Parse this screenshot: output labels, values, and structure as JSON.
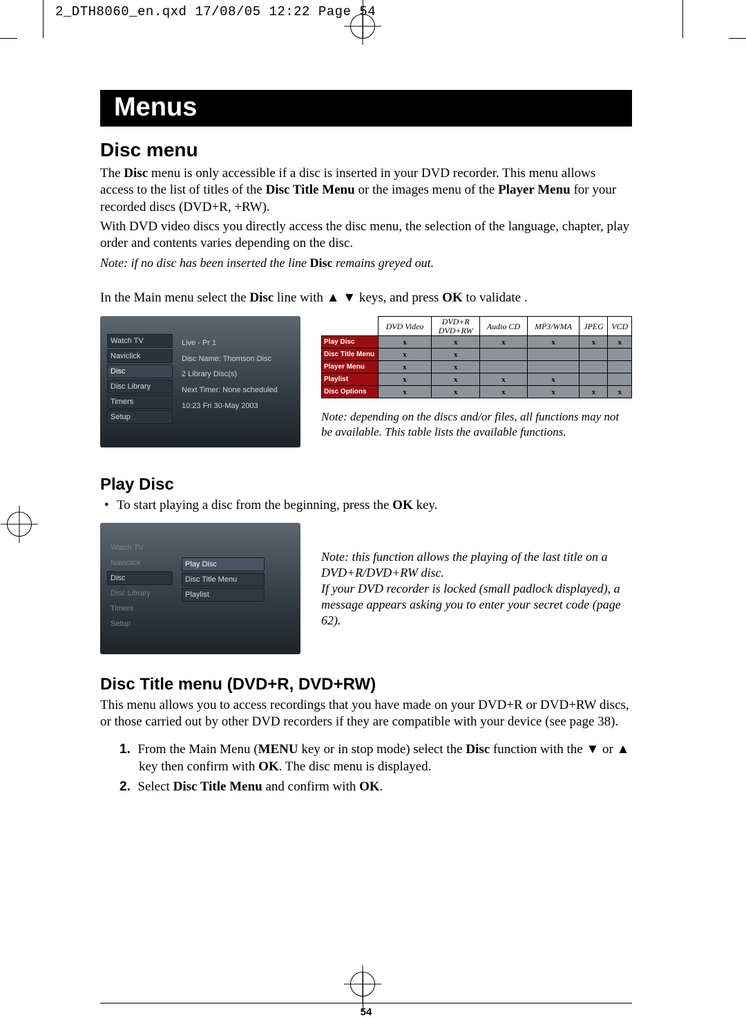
{
  "qxd_header": "2_DTH8060_en.qxd  17/08/05  12:22  Page 54",
  "title_bar": "Menus",
  "disc_menu": {
    "heading": "Disc menu",
    "p1_a": "The ",
    "p1_b": "Disc",
    "p1_c": " menu is only accessible if a disc is inserted in your DVD recorder. This menu allows access to the list of titles of the ",
    "p1_d": "Disc Title Menu",
    "p1_e": " or the images menu of the ",
    "p1_f": "Player Menu",
    "p1_g": " for your recorded discs (DVD+R, +RW).",
    "p2": "With DVD video discs you directly access the disc menu, the selection of the language, chapter, play order and contents varies depending on the disc.",
    "note_a": "Note: if no disc has been inserted the line ",
    "note_b": "Disc",
    "note_c": " remains greyed out.",
    "instr_a": "In the Main menu select the ",
    "instr_b": "Disc",
    "instr_c": " line with ",
    "instr_d": " keys, and press ",
    "instr_e": "OK",
    "instr_f": " to validate ."
  },
  "shot1": {
    "menu": [
      "Watch TV",
      "Naviclick",
      "Disc",
      "Disc Library",
      "Timers",
      "Setup"
    ],
    "info": [
      "Live - Pr 1",
      "",
      "Disc Name: Thomson Disc",
      "2 Library Disc(s)",
      "Next Timer: None scheduled",
      "10:23 Fri 30-May 2003"
    ]
  },
  "func_table": {
    "cols": [
      "DVD Video",
      "DVD+R\nDVD+RW",
      "Audio CD",
      "MP3/WMA",
      "JPEG",
      "VCD"
    ],
    "rows": [
      {
        "label": "Play Disc",
        "cells": [
          "x",
          "x",
          "x",
          "x",
          "x",
          "x"
        ]
      },
      {
        "label": "Disc Title Menu",
        "cells": [
          "x",
          "x",
          "",
          "",
          "",
          ""
        ]
      },
      {
        "label": "Player Menu",
        "cells": [
          "x",
          "x",
          "",
          "",
          "",
          ""
        ]
      },
      {
        "label": "Playlist",
        "cells": [
          "x",
          "x",
          "x",
          "x",
          "",
          ""
        ]
      },
      {
        "label": "Disc Options",
        "cells": [
          "x",
          "x",
          "x",
          "x",
          "x",
          "x"
        ]
      }
    ],
    "note": "Note: depending on the discs and/or files, all functions may not be available. This table lists the available functions."
  },
  "play_disc": {
    "heading": "Play Disc",
    "bullet_a": "To start playing a disc from the beginning, press the ",
    "bullet_b": "OK",
    "bullet_c": " key."
  },
  "shot2": {
    "menu": [
      "Watch TV",
      "Naviclick",
      "Disc",
      "Disc Library",
      "Timers",
      "Setup"
    ],
    "submenu": [
      "Play Disc",
      "Disc Title Menu",
      "Playlist"
    ]
  },
  "shot2_note": {
    "l1": "Note: this function allows the playing of the last title on a DVD+R/DVD+RW disc.",
    "l2": "If your DVD recorder is locked (small padlock displayed), a message appears asking you to enter your secret code (page 62)."
  },
  "title_menu": {
    "heading": "Disc Title menu (DVD+R, DVD+RW)",
    "p": "This menu allows you to access recordings that you have made on your DVD+R or DVD+RW discs, or those carried out by other DVD recorders if they are compatible with your device (see page 38).",
    "s1_a": "From the Main Menu (",
    "s1_b": "MENU",
    "s1_c": " key or in stop mode) select the ",
    "s1_d": "Disc",
    "s1_e": " function with the ",
    "s1_f": " or ",
    "s1_g": " key then confirm with ",
    "s1_h": "OK",
    "s1_i": ". The disc menu is displayed.",
    "s2_a": "Select ",
    "s2_b": "Disc Title Menu",
    "s2_c": " and confirm with ",
    "s2_d": "OK",
    "s2_e": "."
  },
  "page_number": "54"
}
